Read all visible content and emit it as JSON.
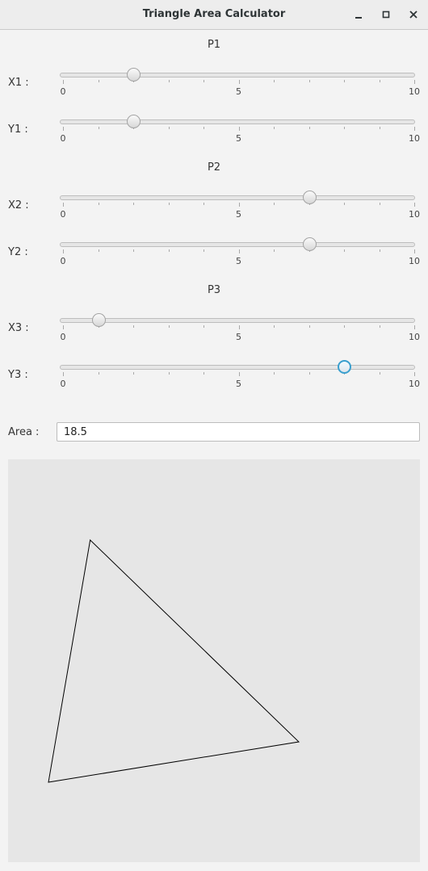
{
  "window": {
    "title": "Triangle Area Calculator",
    "controls": [
      "minimize-icon",
      "maximize-icon",
      "close-icon"
    ]
  },
  "points": [
    {
      "title": "P1",
      "x": {
        "label": "X1 :",
        "value": 2.0
      },
      "y": {
        "label": "Y1 :",
        "value": 2.0
      }
    },
    {
      "title": "P2",
      "x": {
        "label": "X2 :",
        "value": 7.0
      },
      "y": {
        "label": "Y2 :",
        "value": 7.0
      }
    },
    {
      "title": "P3",
      "x": {
        "label": "X3 :",
        "value": 1.0
      },
      "y": {
        "label": "Y3 :",
        "value": 8.0
      }
    }
  ],
  "slider_scale": {
    "min": 0,
    "max": 10,
    "tick_labels": [
      "0",
      "5",
      "10"
    ],
    "minor_ticks": 11
  },
  "focused_slider": "Y3",
  "area": {
    "label": "Area :",
    "value": "18.5"
  },
  "colors": {
    "accent": "#3a9fce",
    "canvas_bg": "#e6e6e6",
    "triangle_stroke": "#000000"
  }
}
